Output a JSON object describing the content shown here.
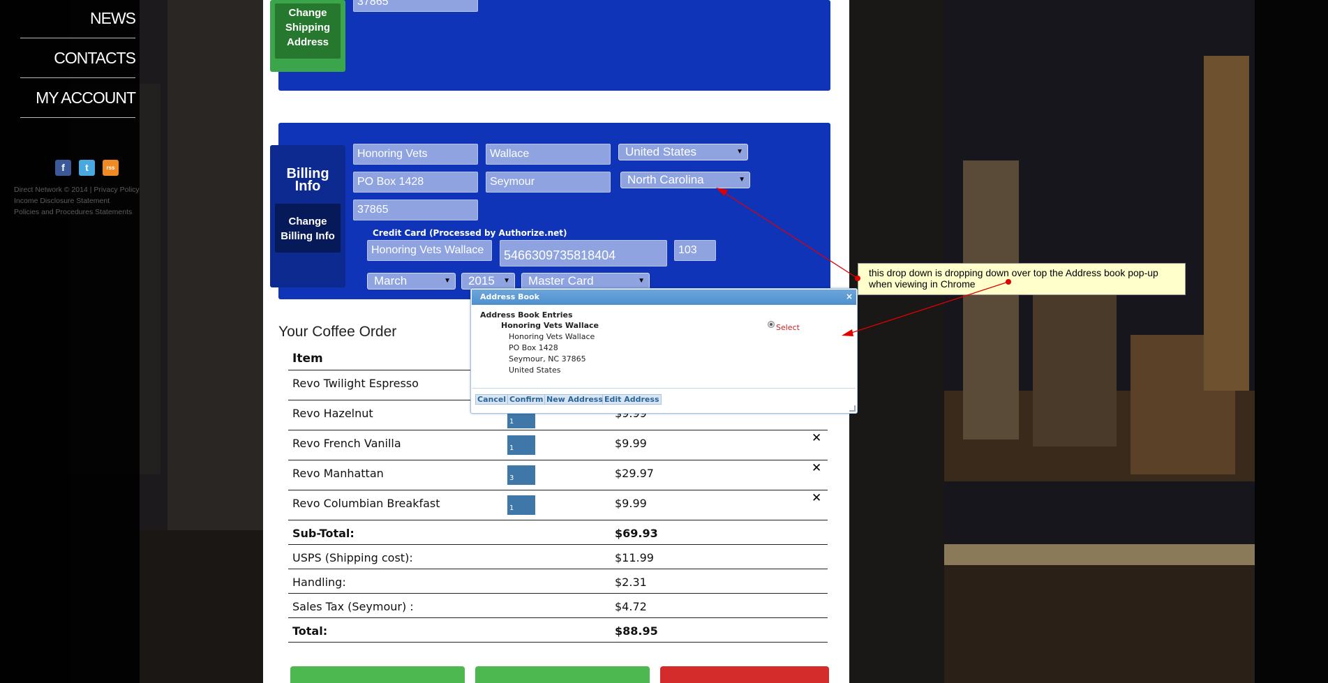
{
  "nav": {
    "items": [
      "NEWS",
      "CONTACTS",
      "MY ACCOUNT"
    ]
  },
  "social": {
    "icons": [
      "facebook-icon",
      "twitter-icon",
      "rss-icon"
    ],
    "glyphs": [
      "f",
      "t",
      "rss"
    ]
  },
  "footer": {
    "line1": "Direct Network © 2014 | Privacy Policy",
    "line2": "Income Disclosure Statement",
    "line3": "Policies and Procedures Statements"
  },
  "shipping": {
    "zip_value": "37865",
    "change_label_1": "Change",
    "change_label_2": "Shipping",
    "change_label_3": "Address"
  },
  "billing": {
    "title_1": "Billing",
    "title_2": "Info",
    "change_label_1": "Change",
    "change_label_2": "Billing Info",
    "first_name": "Honoring Vets",
    "last_name": "Wallace",
    "country": "United States",
    "address": "PO Box 1428",
    "city": "Seymour",
    "state": "North Carolina",
    "zip": "37865",
    "cc_title": "Credit Card (Processed by Authorize.net)",
    "cc_name": "Honoring Vets Wallace",
    "cc_number": "5466309735818404",
    "cvv": "103",
    "exp_month": "March",
    "exp_year": "2015",
    "card_type": "Master Card"
  },
  "order": {
    "title": "Your Coffee Order",
    "header_item": "Item",
    "rows": [
      {
        "item": "Revo Twilight Espresso",
        "qty": "",
        "price": ""
      },
      {
        "item": "Revo Hazelnut",
        "qty": "1",
        "price": "$9.99"
      },
      {
        "item": "Revo French Vanilla",
        "qty": "1",
        "price": "$9.99"
      },
      {
        "item": "Revo Manhattan",
        "qty": "3",
        "price": "$29.97"
      },
      {
        "item": "Revo Columbian Breakfast",
        "qty": "1",
        "price": "$9.99"
      }
    ],
    "delete_glyph": "✕",
    "subtotal_label": "Sub-Total:",
    "subtotal_value": "$69.93",
    "shipping_label": "USPS (Shipping cost):",
    "shipping_value": "$11.99",
    "handling_label": "Handling:",
    "handling_value": "$2.31",
    "tax_label": "Sales Tax (Seymour) :",
    "tax_value": "$4.72",
    "total_label": "Total:",
    "total_value": "$88.95"
  },
  "popup": {
    "title": "Address Book",
    "close": "×",
    "section": "Address Book Entries",
    "entry_name": "Honoring Vets Wallace",
    "line1": "Honoring Vets Wallace",
    "line2": "PO Box 1428",
    "line3": "Seymour, NC 37865",
    "line4": "United States",
    "select_label": "Select",
    "buttons": [
      "Cancel",
      "Confirm",
      "New Address",
      "Edit Address"
    ]
  },
  "annotation": {
    "line1": "this drop down is dropping down over top the Address book pop-up",
    "line2": "when viewing in Chrome"
  },
  "colors": {
    "panel_blue": "#0f34b8",
    "green": "#3aa54a",
    "red": "#d22a2a",
    "annotation_red": "#e00000"
  }
}
